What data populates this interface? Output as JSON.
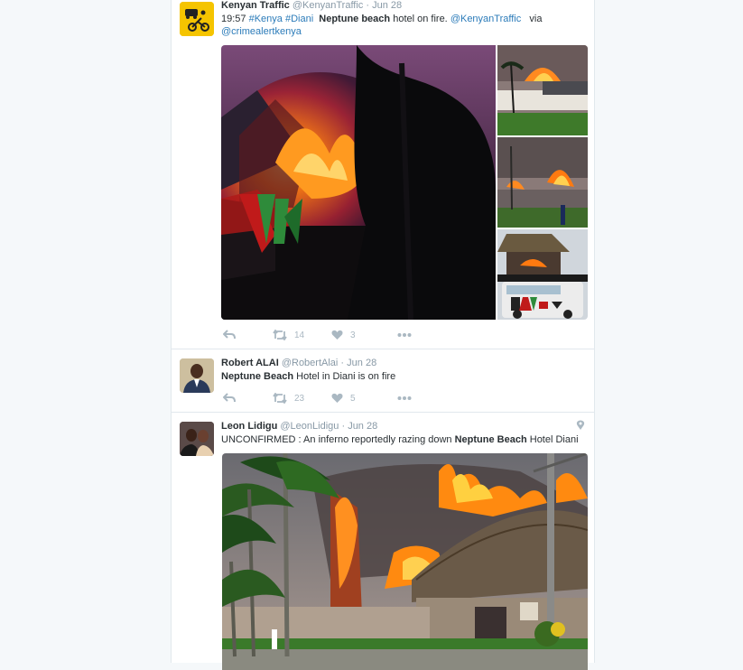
{
  "tweets": [
    {
      "name": "Kenyan Traffic",
      "handle": "@KenyanTraffic",
      "dot": "·",
      "date": "Jun 28",
      "text": {
        "time": "19:57",
        "tag1": "#Kenya",
        "tag2": "#Diani",
        "bold": "Neptune beach",
        "rest": "hotel on fire.",
        "mention1": "@KenyanTraffic",
        "via": "via",
        "mention2": "@crimealertkenya"
      },
      "actions": {
        "retweets": "14",
        "likes": "3"
      }
    },
    {
      "name": "Robert ALAI",
      "handle": "@RobertAlai",
      "dot": "·",
      "date": "Jun 28",
      "text": {
        "bold": "Neptune Beach",
        "rest": "Hotel in Diani is on fire"
      },
      "actions": {
        "retweets": "23",
        "likes": "5"
      }
    },
    {
      "name": "Leon Lidigu",
      "handle": "@LeonLidigu",
      "dot": "·",
      "date": "Jun 28",
      "text": {
        "pre": "UNCONFIRMED : An inferno reportedly razing down",
        "bold": "Neptune Beach",
        "rest": "Hotel Diani"
      }
    }
  ],
  "icons": {
    "reply": "reply-icon",
    "retweet": "retweet-icon",
    "like": "heart-icon",
    "more": "more-icon",
    "location": "location-pin-icon"
  },
  "colors": {
    "link": "#2b7bb9",
    "muted": "#8899a6",
    "icon": "#aab8c2",
    "accent_yellow": "#f5c400"
  }
}
